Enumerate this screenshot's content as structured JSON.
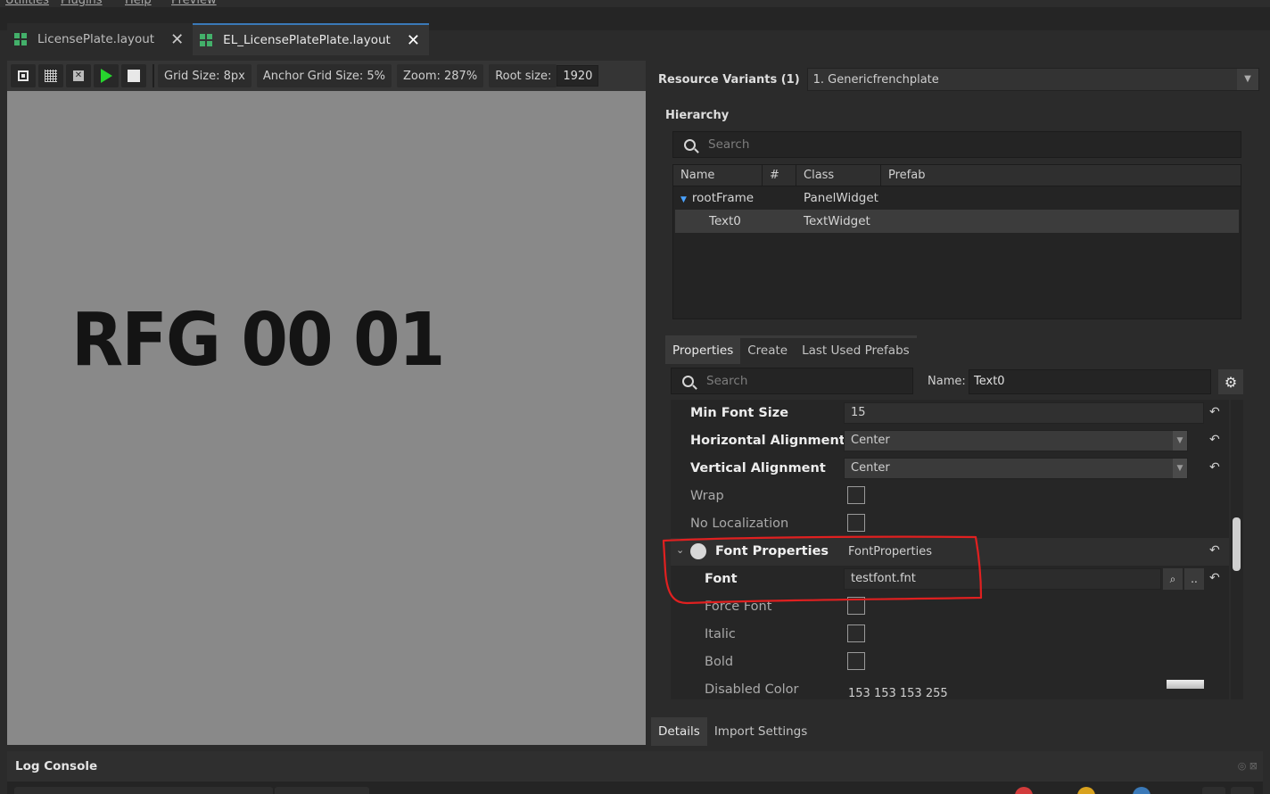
{
  "menu": {
    "items": [
      "Utilities",
      "Plugins",
      "Help",
      "Preview"
    ]
  },
  "tabs": [
    {
      "label": "LicensePlate.layout",
      "active": false
    },
    {
      "label": "EL_LicensePlatePlate.layout",
      "active": true
    }
  ],
  "toolbar": {
    "grid_size": "Grid Size: 8px",
    "anchor_grid": "Anchor Grid Size: 5%",
    "zoom": "Zoom: 287%",
    "root_size_label": "Root size:",
    "root_size_value": "1920"
  },
  "viewport": {
    "plate_text": "RFG 00 01"
  },
  "resource_variants": {
    "label": "Resource Variants (1)",
    "selected": "1. Genericfrenchplate"
  },
  "hierarchy": {
    "title": "Hierarchy",
    "search_placeholder": "Search",
    "columns": [
      "Name",
      "#",
      "Class",
      "Prefab"
    ],
    "rows": [
      {
        "name": "rootFrame",
        "class": "PanelWidget",
        "expanded": true,
        "selected": false
      },
      {
        "name": "Text0",
        "class": "TextWidget",
        "selected": true
      }
    ]
  },
  "properties": {
    "tabs": [
      "Properties",
      "Create",
      "Last Used Prefabs"
    ],
    "search_placeholder": "Search",
    "name_label": "Name:",
    "name_value": "Text0",
    "rows": {
      "min_font_size": {
        "label": "Min Font Size",
        "value": "15"
      },
      "h_align": {
        "label": "Horizontal Alignment",
        "value": "Center"
      },
      "v_align": {
        "label": "Vertical Alignment",
        "value": "Center"
      },
      "wrap": {
        "label": "Wrap"
      },
      "no_localization": {
        "label": "No Localization"
      },
      "font_properties": {
        "label": "Font Properties",
        "value": "FontProperties"
      },
      "font": {
        "label": "Font",
        "value": "testfont.fnt"
      },
      "force_font": {
        "label": "Force Font"
      },
      "italic": {
        "label": "Italic"
      },
      "bold": {
        "label": "Bold"
      },
      "disabled_color": {
        "label": "Disabled Color",
        "value": "153 153 153 255"
      }
    }
  },
  "bottom_tabs": [
    "Details",
    "Import Settings"
  ],
  "log_console": {
    "title": "Log Console"
  },
  "colors": {
    "accent": "#3a79b8",
    "play": "#27d52e",
    "annotation": "#e02020",
    "canvas": "#898989"
  }
}
